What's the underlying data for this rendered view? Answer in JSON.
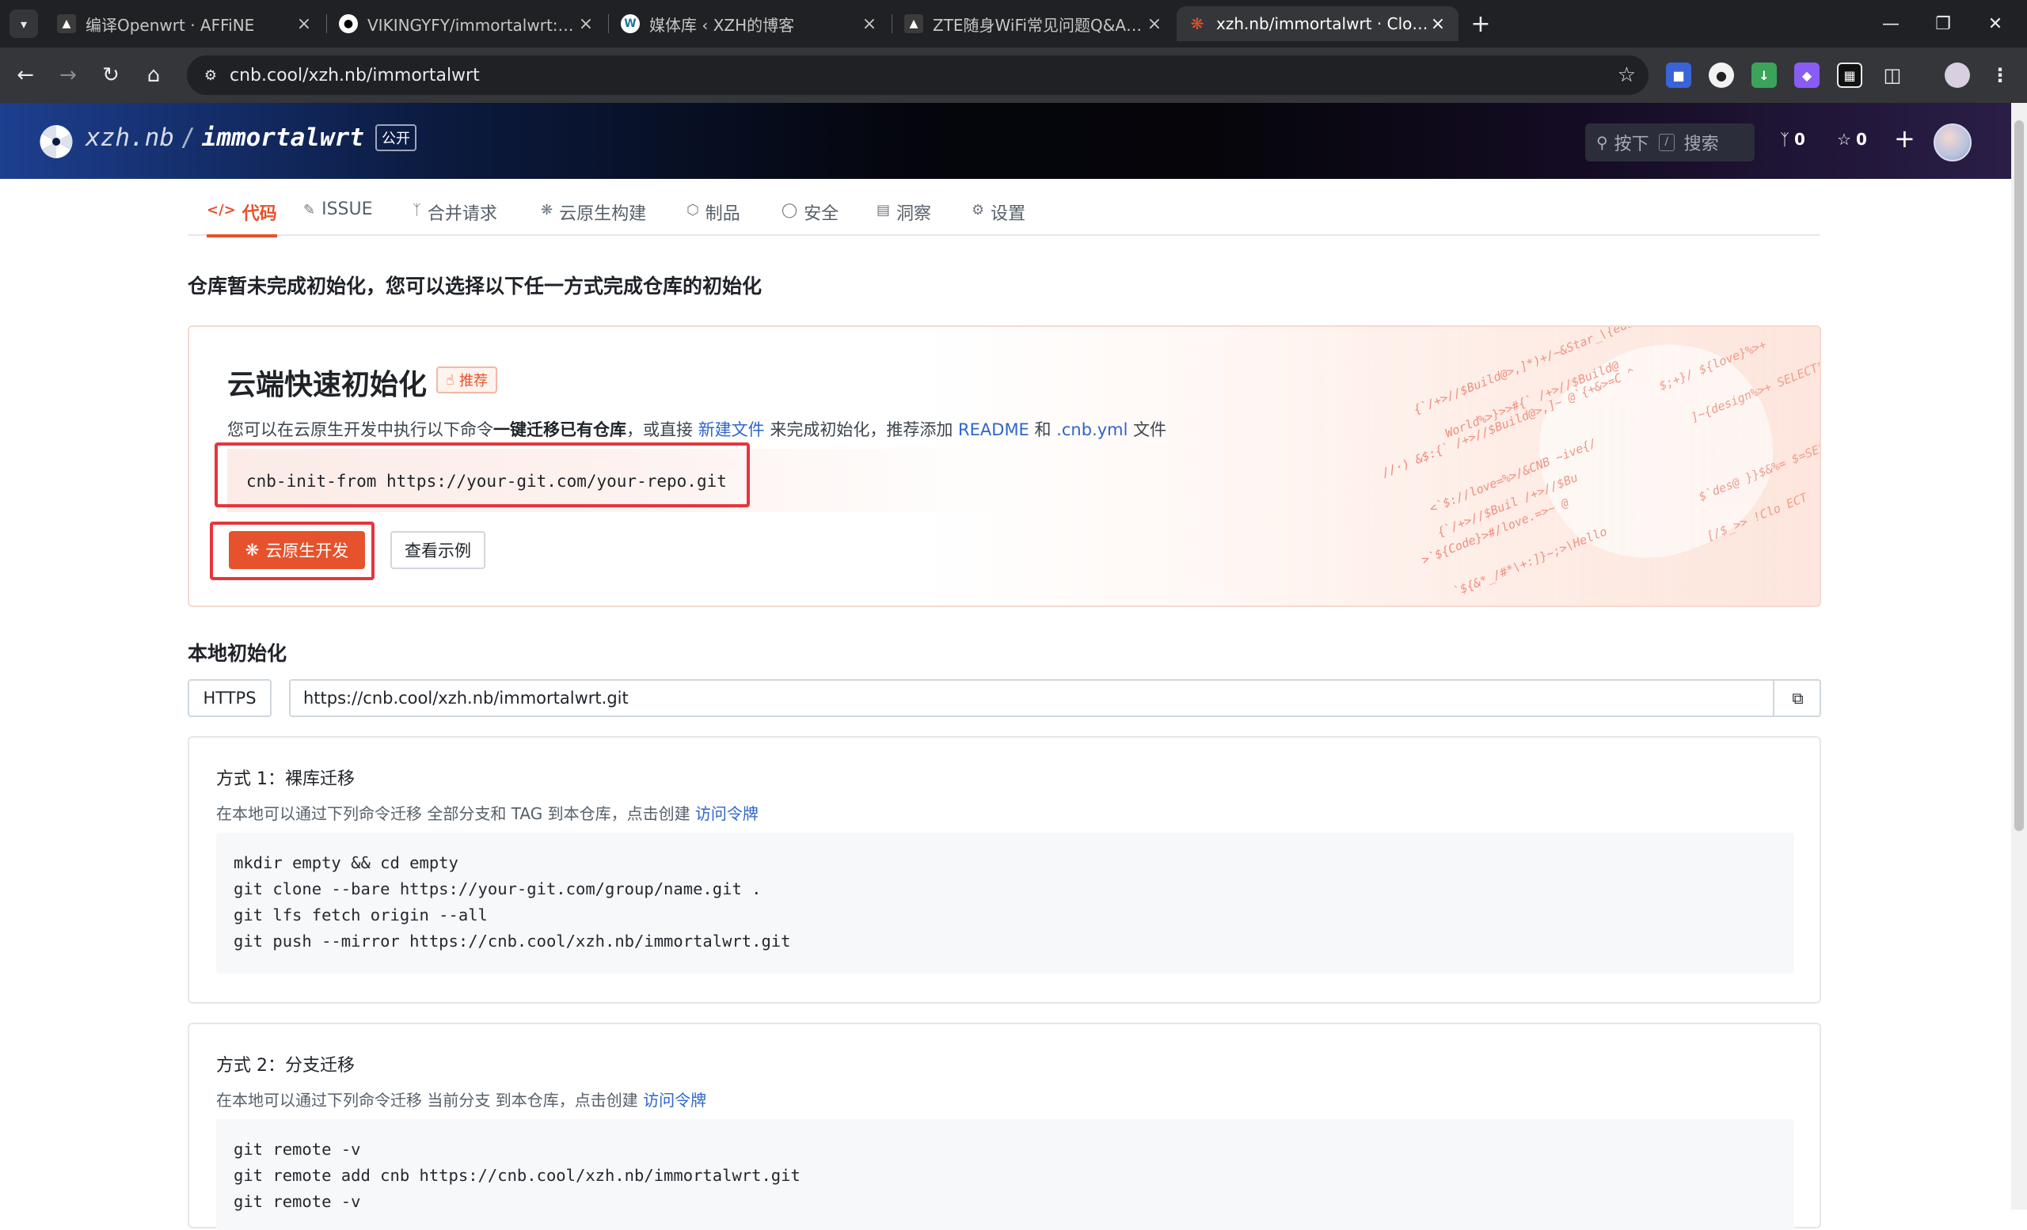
{
  "browser": {
    "tabs": [
      {
        "title": "编译Openwrt · AFFiNE"
      },
      {
        "title": "VIKINGYFY/immortalwrt: 自用"
      },
      {
        "title": "媒体库 ‹ XZH的博客"
      },
      {
        "title": "ZTE随身WiFi常见问题Q&A · A"
      },
      {
        "title": "xzh.nb/immortalwrt · Cloud N"
      }
    ],
    "address": "cnb.cool/xzh.nb/immortalwrt"
  },
  "header": {
    "owner": "xzh.nb",
    "separator": "/",
    "repo": "immortalwrt",
    "visibility": "公开",
    "search_prefix": "按下",
    "search_key": "/",
    "search_label": "搜索",
    "forks": "0",
    "stars": "0"
  },
  "repo_nav": {
    "tabs": [
      "代码",
      "ISSUE",
      "合并请求",
      "云原生构建",
      "制品",
      "安全",
      "洞察",
      "设置"
    ]
  },
  "notice": "仓库暂未完成初始化，您可以选择以下任一方式完成仓库的初始化",
  "cloud_init": {
    "title": "云端快速初始化",
    "badge": "推荐",
    "desc_prefix": "您可以在云原生开发中执行以下命令",
    "desc_bold": "一键迁移已有仓库",
    "desc_mid": "，或直接 ",
    "desc_link_new": "新建文件",
    "desc_mid2": " 来完成初始化，推荐添加 ",
    "desc_link_readme": "README",
    "desc_and": " 和 ",
    "desc_link_cnb": ".cnb.yml",
    "desc_suffix": " 文件",
    "command": "cnb-init-from https://your-git.com/your-repo.git",
    "button_primary": "云原生开发",
    "button_secondary": "查看示例"
  },
  "local_init": {
    "title": "本地初始化",
    "protocol": "HTTPS",
    "clone_url": "https://cnb.cool/xzh.nb/immortalwrt.git",
    "method1": {
      "title": "方式 1：裸库迁移",
      "desc_prefix": "在本地可以通过下列命令迁移 全部分支和 TAG 到本仓库，点击创建 ",
      "desc_link": "访问令牌",
      "code": [
        "mkdir empty && cd empty",
        "git clone --bare https://your-git.com/group/name.git .",
        "git lfs fetch origin --all",
        "git push --mirror https://cnb.cool/xzh.nb/immortalwrt.git"
      ]
    },
    "method2": {
      "title": "方式 2：分支迁移",
      "desc_prefix": "在本地可以通过下列命令迁移 当前分支 到本仓库，点击创建 ",
      "desc_link": "访问令牌",
      "code": [
        "git remote -v",
        "git remote add cnb https://cnb.cool/xzh.nb/immortalwrt.git",
        "git remote -v"
      ]
    }
  },
  "colors": {
    "accent": "#e6522c",
    "highlight": "#e8343d",
    "link": "#2f65c9"
  }
}
